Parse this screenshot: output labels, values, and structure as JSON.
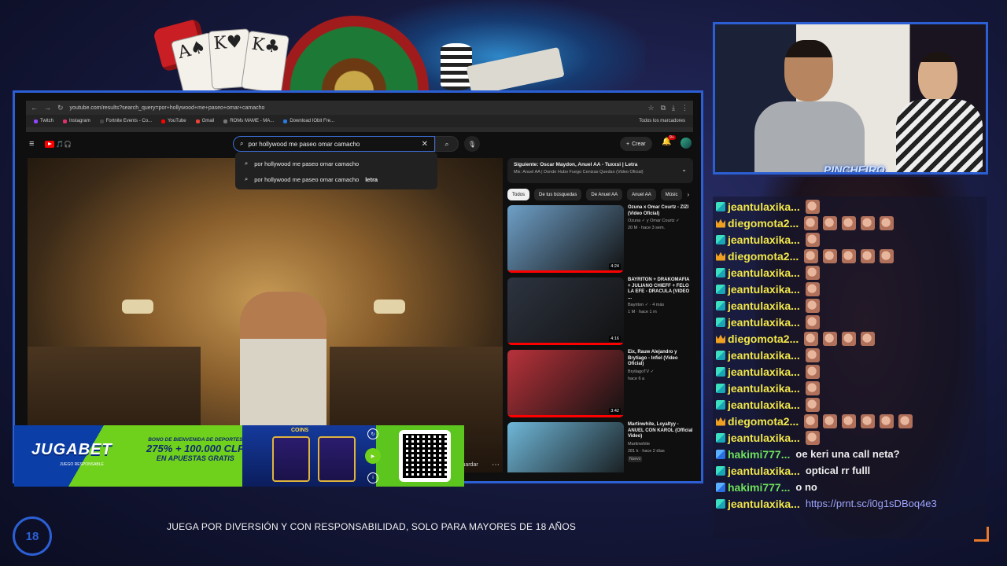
{
  "browser": {
    "url": "youtube.com/results?search_query=por+hollywood+me+paseo+omar+camacho",
    "bookmarks": [
      {
        "label": "Twitch",
        "color": "#9146ff"
      },
      {
        "label": "Instagram",
        "color": "#e1306c"
      },
      {
        "label": "Fortnite Events - Co...",
        "color": "#444"
      },
      {
        "label": "YouTube",
        "color": "#ff0000"
      },
      {
        "label": "Gmail",
        "color": "#ea4335"
      },
      {
        "label": "ROMs MAME - MA...",
        "color": "#777"
      },
      {
        "label": "Download IObit Fre...",
        "color": "#2a7ae2"
      }
    ],
    "bookmarks_right": "Todos los marcadores"
  },
  "youtube": {
    "logo_text": "🎵🎧",
    "search_value": "por hollywood me paseo omar camacho",
    "suggestions": [
      {
        "text": "por hollywood me paseo omar camacho",
        "bold": ""
      },
      {
        "text": "por hollywood me paseo omar camacho ",
        "bold": "letra"
      }
    ],
    "create_label": "Crear",
    "notif_count": "9+",
    "save_label": "Guardar",
    "mix_title": "Siguiente: Oscar Maydon, Anuel AA - Tuxxsi | Letra",
    "mix_sub": "Mix: Anuel AA | Donde Hubo Fuego Cenizas Quedan (Video Oficial)",
    "chips": [
      "Todos",
      "De tus búsquedas",
      "De Anuel AA",
      "Anuel AA",
      "Músic"
    ],
    "recommendations": [
      {
        "title": "Ozuna x Omar Courtz - ZIZI (Video Oficial)",
        "channel": "Ozuna ✓ y Omar Courtz ✓",
        "meta": "20 M · hace 3 sem.",
        "duration": "4:24",
        "thumb": "#6fa0c8",
        "progress": 1.0,
        "badge": ""
      },
      {
        "title": "BAYRITON + DRAKOMAFIA + JULIANO CHIEFF + FELO LA EFE - DRACULA (VIDEO ...",
        "channel": "Bayriton ✓ · 4 más",
        "meta": "1 M · hace 1 m",
        "duration": "4:16",
        "thumb": "#2d3440",
        "progress": 1.0,
        "badge": ""
      },
      {
        "title": "Eix, Rauw Alejandro y Brytiago - Infiel (Video Oficial)",
        "channel": "BrytiagoTV ✓",
        "meta": "hace 6 a",
        "duration": "3:42",
        "thumb": "#b8323a",
        "progress": 1.0,
        "badge": ""
      },
      {
        "title": "Martinwhite, Loyaltyy - ANUEL CON KAROL (Official Video)",
        "channel": "Martinwhite",
        "meta": "281 k · hace 2 días",
        "duration": "",
        "thumb": "#6fb7d8",
        "progress": 0,
        "badge": "Nuevo"
      }
    ]
  },
  "ad": {
    "brand": "JUGA",
    "brand2": "BET",
    "resp": "JUEGO RESPONSABLE",
    "offer_line1": "BONO DE BIENVENIDA DE DEPORTES",
    "offer_line2": "275% + 100.000 CLP",
    "offer_line3": "EN APUESTAS GRATIS",
    "coins": "COINS",
    "disclaimer": "JUEGA POR DIVERSIÓN Y CON RESPONSABILIDAD,  SOLO PARA MAYORES DE 18 AÑOS",
    "age": "18"
  },
  "webcam": {
    "name": "PINCHEIRO"
  },
  "chat": {
    "messages": [
      {
        "user": "jeantulaxika...",
        "icon": "teal",
        "color": "u-yellow",
        "emotes": 1,
        "text": "",
        "link": ""
      },
      {
        "user": "diegomota2...",
        "icon": "crown",
        "color": "u-yellow",
        "emotes": 5,
        "text": "",
        "link": ""
      },
      {
        "user": "jeantulaxika...",
        "icon": "teal",
        "color": "u-yellow",
        "emotes": 1,
        "text": "",
        "link": ""
      },
      {
        "user": "diegomota2...",
        "icon": "crown",
        "color": "u-yellow",
        "emotes": 5,
        "text": "",
        "link": ""
      },
      {
        "user": "jeantulaxika...",
        "icon": "teal",
        "color": "u-yellow",
        "emotes": 1,
        "text": "",
        "link": ""
      },
      {
        "user": "jeantulaxika...",
        "icon": "teal",
        "color": "u-yellow",
        "emotes": 1,
        "text": "",
        "link": ""
      },
      {
        "user": "jeantulaxika...",
        "icon": "teal",
        "color": "u-yellow",
        "emotes": 1,
        "text": "",
        "link": ""
      },
      {
        "user": "jeantulaxika...",
        "icon": "teal",
        "color": "u-yellow",
        "emotes": 1,
        "text": "",
        "link": ""
      },
      {
        "user": "diegomota2...",
        "icon": "crown",
        "color": "u-yellow",
        "emotes": 4,
        "text": "",
        "link": ""
      },
      {
        "user": "jeantulaxika...",
        "icon": "teal",
        "color": "u-yellow",
        "emotes": 1,
        "text": "",
        "link": ""
      },
      {
        "user": "jeantulaxika...",
        "icon": "teal",
        "color": "u-yellow",
        "emotes": 1,
        "text": "",
        "link": ""
      },
      {
        "user": "jeantulaxika...",
        "icon": "teal",
        "color": "u-yellow",
        "emotes": 1,
        "text": "",
        "link": ""
      },
      {
        "user": "jeantulaxika...",
        "icon": "teal",
        "color": "u-yellow",
        "emotes": 1,
        "text": "",
        "link": ""
      },
      {
        "user": "diegomota2...",
        "icon": "crown",
        "color": "u-yellow",
        "emotes": 6,
        "text": "",
        "link": ""
      },
      {
        "user": "jeantulaxika...",
        "icon": "teal",
        "color": "u-yellow",
        "emotes": 1,
        "text": "",
        "link": ""
      },
      {
        "user": "hakimi777...",
        "icon": "blue",
        "color": "u-green",
        "emotes": 0,
        "text": "oe keri una call neta?",
        "link": ""
      },
      {
        "user": "jeantulaxika...",
        "icon": "teal",
        "color": "u-yellow",
        "emotes": 0,
        "text": "optical rr fulll",
        "link": ""
      },
      {
        "user": "hakimi777...",
        "icon": "blue",
        "color": "u-green",
        "emotes": 0,
        "text": "o no",
        "link": ""
      },
      {
        "user": "jeantulaxika...",
        "icon": "teal",
        "color": "u-yellow",
        "emotes": 0,
        "text": "",
        "link": "https://prnt.sc/i0g1sDBoq4e3"
      }
    ]
  }
}
